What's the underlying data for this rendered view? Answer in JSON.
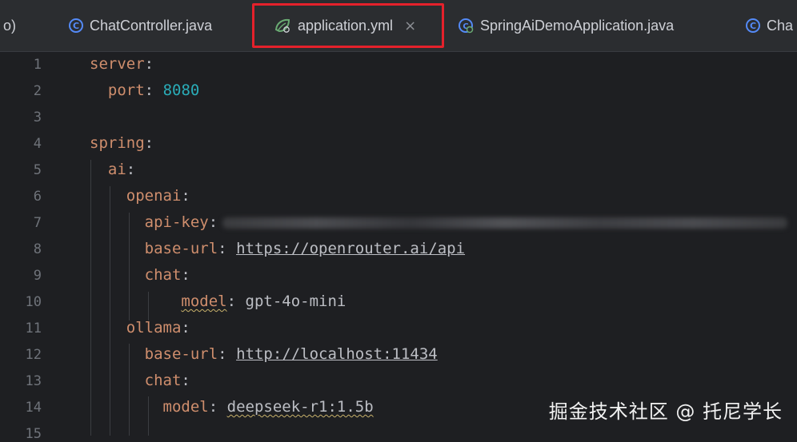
{
  "tabs": [
    {
      "label": "ChatController.java",
      "icon": "class-icon",
      "active": false
    },
    {
      "label": "application.yml",
      "icon": "spring-config-icon",
      "active": true
    },
    {
      "label": "SpringAiDemoApplication.java",
      "icon": "spring-boot-class-icon",
      "active": false
    },
    {
      "label": "Cha",
      "icon": "class-icon",
      "active": false
    }
  ],
  "tab_prefix": "o)",
  "close_glyph": "×",
  "class_glyph": "C",
  "line_numbers": [
    "1",
    "2",
    "3",
    "4",
    "5",
    "6",
    "7",
    "8",
    "9",
    "10",
    "11",
    "12",
    "13",
    "14",
    "15"
  ],
  "code": {
    "l1_key": "server",
    "colon": ":",
    "l2_key": "port",
    "l2_value": "8080",
    "l4_key": "spring",
    "l5_key": "ai",
    "l6_key": "openai",
    "l7_key": "api-key",
    "l8_key": "base-url",
    "l8_value": "https://openrouter.ai/api",
    "l9_key": "chat",
    "l10_key": "model",
    "l10_value": "gpt-4o-mini",
    "l11_key": "ollama",
    "l12_key": "base-url",
    "l12_value": "http://localhost:11434",
    "l13_key": "chat",
    "l14_key": "model",
    "l14_value": "deepseek-r1:1.5b"
  },
  "watermark": "掘金技术社区 @ 托尼学长",
  "colors": {
    "background": "#1e1f22",
    "key": "#cf8e6d",
    "number": "#2aacb8",
    "highlight": "#e5212b"
  }
}
